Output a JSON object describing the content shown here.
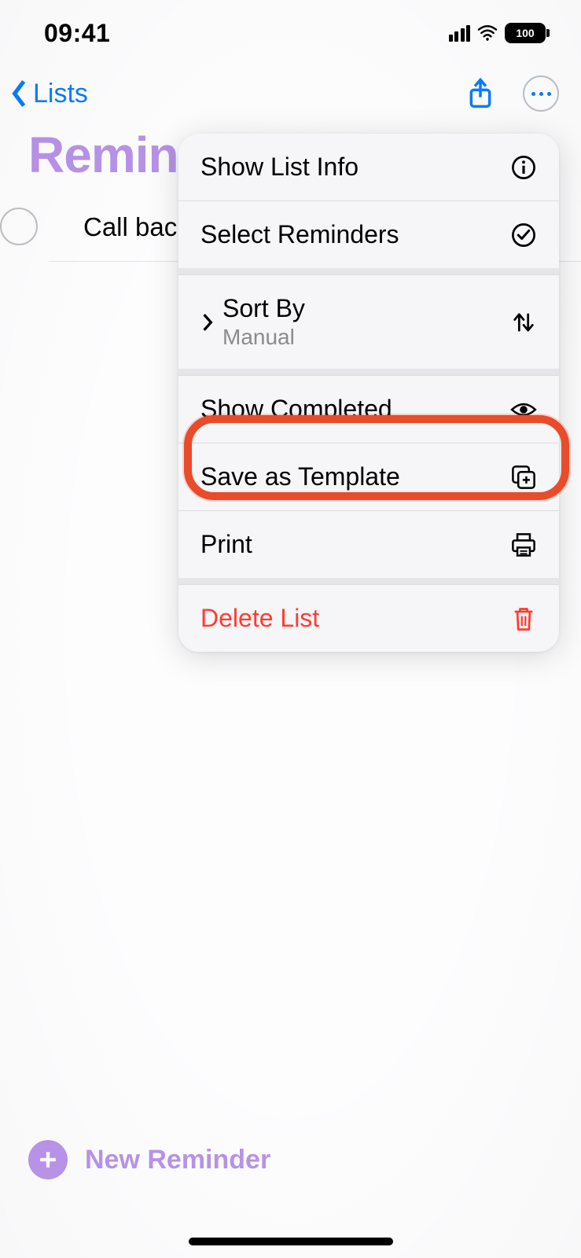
{
  "status": {
    "time": "09:41",
    "battery": "100"
  },
  "nav": {
    "back_label": "Lists"
  },
  "list": {
    "title": "Reminders",
    "items": [
      {
        "text": "Call back"
      }
    ]
  },
  "menu": {
    "show_info": "Show List Info",
    "select": "Select Reminders",
    "sort_by": "Sort By",
    "sort_value": "Manual",
    "show_completed": "Show Completed",
    "save_template": "Save as Template",
    "print": "Print",
    "delete": "Delete List"
  },
  "footer": {
    "new_reminder": "New Reminder"
  },
  "highlight": {
    "target": "save_template"
  }
}
